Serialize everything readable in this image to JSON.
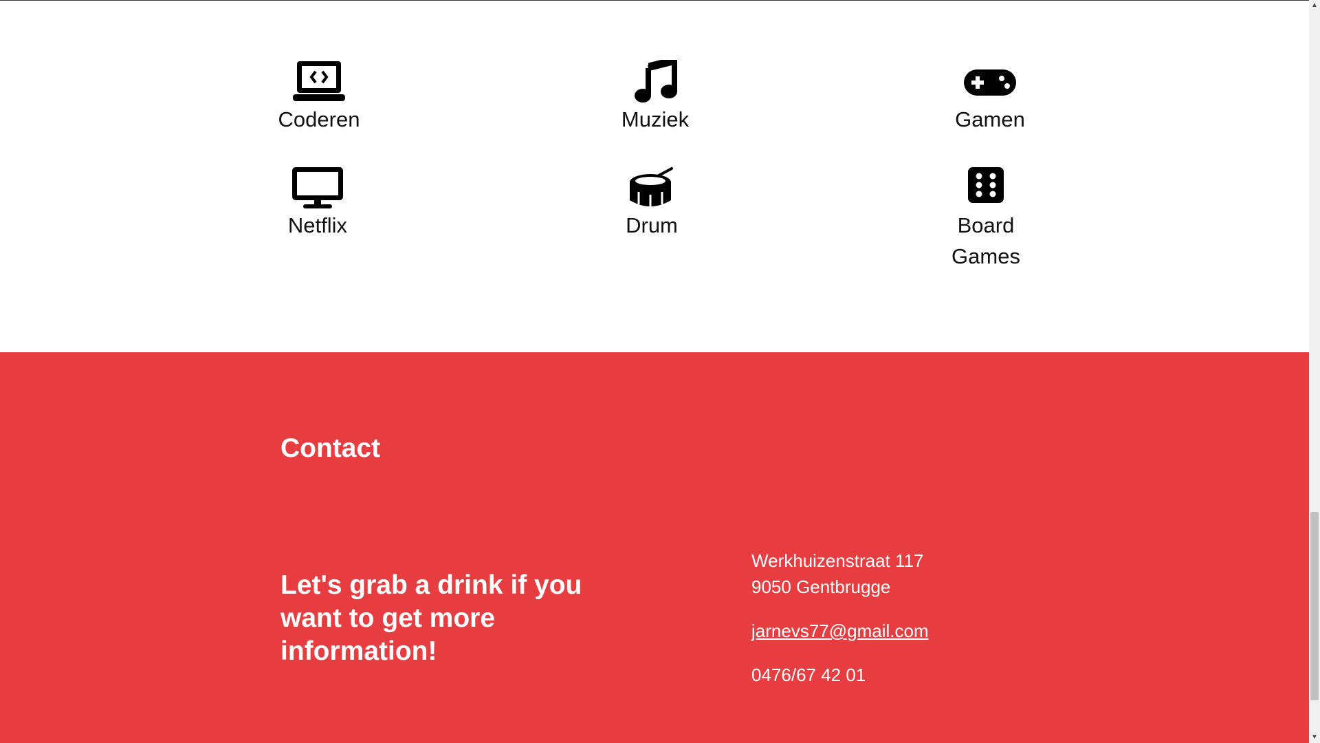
{
  "hobbies": {
    "items": [
      {
        "label": "Coderen",
        "icon": "laptop-code-icon"
      },
      {
        "label": "Muziek",
        "icon": "music-note-icon"
      },
      {
        "label": "Gamen",
        "icon": "gamepad-icon"
      },
      {
        "label": "Netflix",
        "icon": "tv-monitor-icon"
      },
      {
        "label": "Drum",
        "icon": "drum-icon"
      },
      {
        "label": "Board Games",
        "icon": "dice-icon"
      }
    ]
  },
  "contact": {
    "title": "Contact",
    "tagline": "Let's grab a drink if you want to get more information!",
    "address_line1": "Werkhuizenstraat 117",
    "address_line2": "9050 Gentbrugge",
    "email": "jarnevs77@gmail.com",
    "phone": "0476/67 42 01"
  },
  "colors": {
    "contact_background": "#e83d40",
    "text_light": "#ffffff",
    "text_dark": "#111111"
  }
}
